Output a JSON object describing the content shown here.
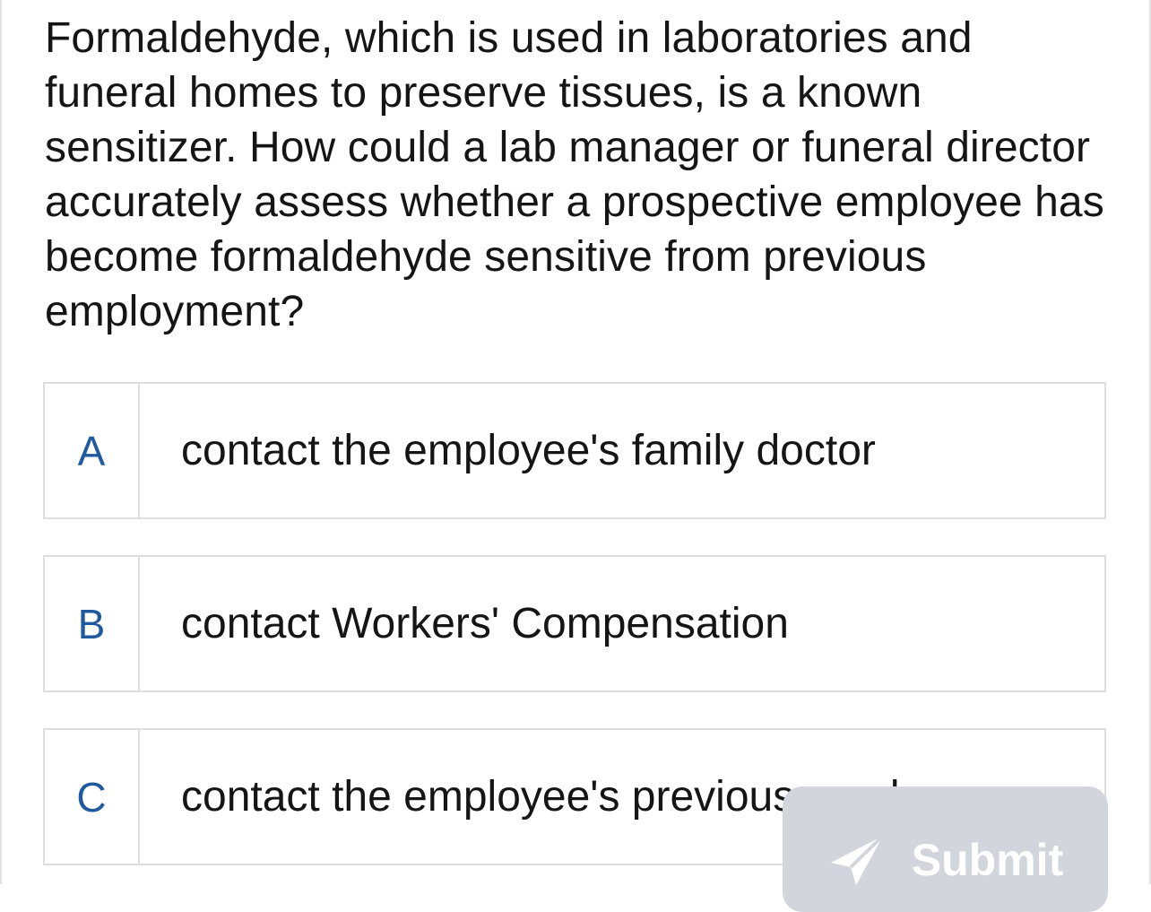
{
  "question": {
    "text": "Formaldehyde, which is used in laboratories and funeral homes to preserve tissues, is a known sensitizer. How could a lab manager or funeral director accurately assess whether a prospective employee has become formaldehyde sensitive from previous employment?"
  },
  "options": [
    {
      "letter": "A",
      "text": "contact the employee's family doctor"
    },
    {
      "letter": "B",
      "text": "contact Workers' Compensation"
    },
    {
      "letter": "C",
      "text": "contact the employee's previous employer"
    }
  ],
  "submit": {
    "label": "Submit",
    "icon": "paper-plane-icon"
  },
  "colors": {
    "letter": "#1f5a9f",
    "submit_bg": "#d2d5dc",
    "border": "#dedede"
  }
}
